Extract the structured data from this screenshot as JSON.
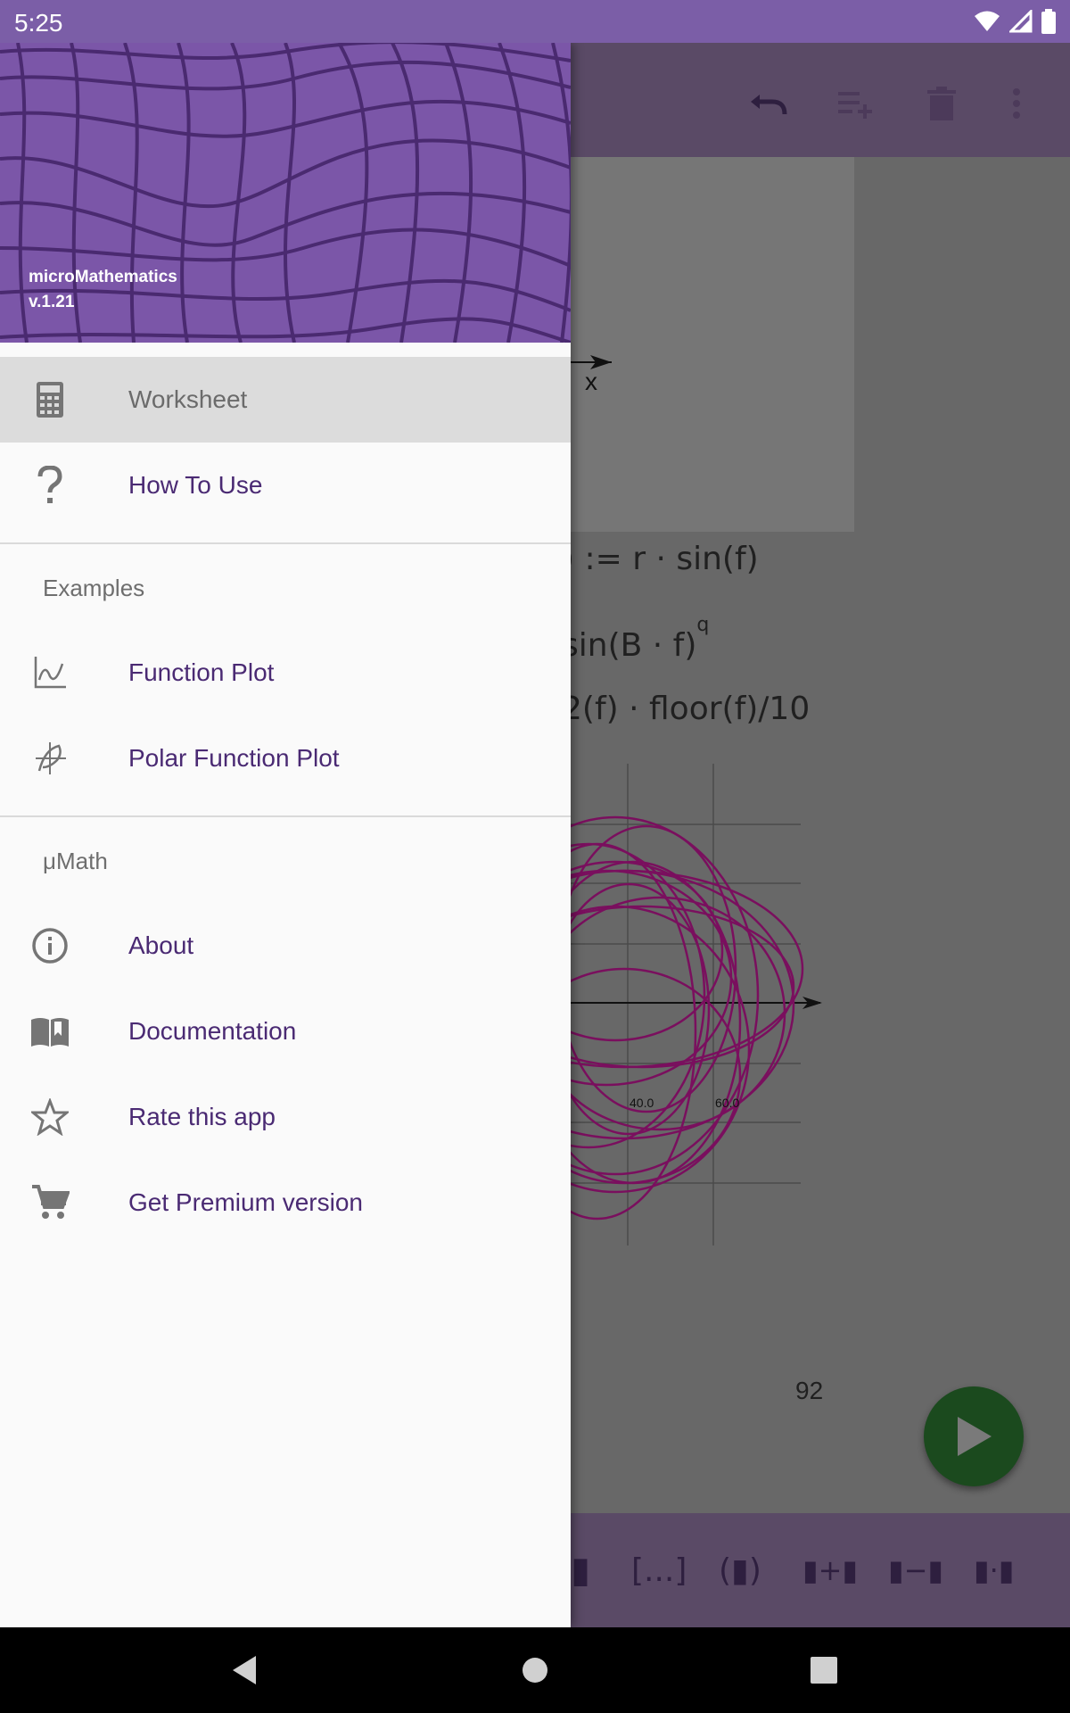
{
  "status_bar": {
    "time": "5:25"
  },
  "drawer": {
    "header": {
      "app_name": "microMathematics",
      "version": "v.1.21"
    },
    "items_top": [
      {
        "label": "Worksheet",
        "icon": "calculator-icon",
        "selected": true
      },
      {
        "label": "How To Use",
        "icon": "question-icon"
      }
    ],
    "section_examples": "Examples",
    "examples": [
      {
        "label": "Function Plot",
        "icon": "function-plot-icon"
      },
      {
        "label": "Polar Function Plot",
        "icon": "polar-plot-icon"
      }
    ],
    "section_umath": "μMath",
    "umath_items": [
      {
        "label": "About",
        "icon": "info-icon"
      },
      {
        "label": "Documentation",
        "icon": "book-icon"
      },
      {
        "label": "Rate this app",
        "icon": "star-outline-icon"
      },
      {
        "label": "Get Premium version",
        "icon": "cart-icon"
      }
    ]
  },
  "worksheet": {
    "toolbar_icons": [
      "undo-icon",
      "playlist-add-icon",
      "delete-icon",
      "more-vert-icon"
    ],
    "plot1_axis_label": "x",
    "formulas": {
      "f1": ") := r · sin(f)",
      "f2": "sin(B · f)",
      "f2_sup": "q",
      "f3": "2(f) · floor(f)/10"
    },
    "polar_ticks": [
      "40.0",
      "60.0"
    ],
    "page_number": "92",
    "bottom_toolbar": [
      "▮",
      "[...]",
      "(▮)",
      "▮+▮",
      "▮−▮",
      "▮·▮"
    ],
    "run_button_icon": "play-icon"
  },
  "colors": {
    "status_bar": "#7b5ea7",
    "drawer_header": "#7b56a8",
    "accent_text": "#4a2a73",
    "plot_curve": "#7a0f5e",
    "fab": "#1b4a1e"
  }
}
